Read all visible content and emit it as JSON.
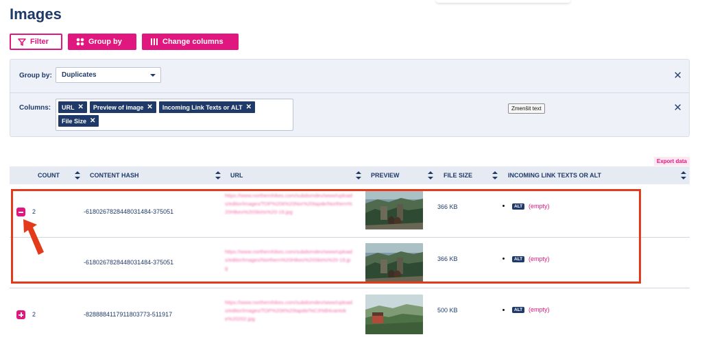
{
  "page": {
    "title": "Images"
  },
  "toolbar": {
    "filter_label": "Filter",
    "group_by_label": "Group by",
    "change_columns_label": "Change columns"
  },
  "group_panel": {
    "group_by_label": "Group by:",
    "group_by_value": "Duplicates",
    "columns_label": "Columns:",
    "columns": [
      "URL",
      "Preview of image",
      "Incoming Link Texts or ALT",
      "File Size"
    ],
    "tooltip": "Zmenšit text"
  },
  "table": {
    "export_label": "Export data",
    "headers": [
      "COUNT",
      "CONTENT HASH",
      "URL",
      "PREVIEW",
      "FILE SIZE",
      "INCOMING LINK TEXTS OR ALT"
    ],
    "alt_badge": "ALT",
    "empty_text": "(empty)",
    "rows": [
      {
        "count": "2",
        "hash": "-6180267828448031484-375051",
        "url": "https://www.northernhikes.com/subdomdev/www/uploads/editor/images/TOP%20it%20Nor%20tapde/Northern%20Hikes%20Skirts%20-19.jpg",
        "size": "366 KB"
      },
      {
        "count": "",
        "hash": "-6180267828448031484-375051",
        "url": "https://www.northernhikes.com/subdomdev/www/uploads/editor/images/Northern%20Hikes%20Skirts%20-19.jpg",
        "size": "366 KB"
      },
      {
        "count": "2",
        "hash": "-8288884117911803773-511917",
        "url": "https://www.northernhikes.com/subdomdev/www/uploads/editor/images/TOP%20it%20tapde/%C3%B4vantoke%20202.jpg",
        "size": "500 KB"
      }
    ]
  },
  "colors": {
    "accent": "#e0177f",
    "navy": "#1f3a68",
    "highlight": "#e23a1a"
  }
}
